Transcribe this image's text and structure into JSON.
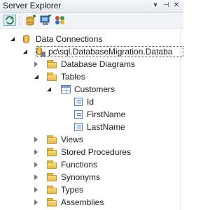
{
  "window": {
    "title": "Server Explorer",
    "controls": [
      "dropdown-icon",
      "pin-icon",
      "close-icon"
    ]
  },
  "toolbar": {
    "buttons": [
      "refresh-icon",
      "connect-to-database-icon",
      "connect-to-server-icon",
      "azure-icon"
    ]
  },
  "tree": {
    "data_connections": "Data Connections",
    "connection": "pc\\sql.DatabaseMigration.Databa",
    "database_diagrams": "Database Diagrams",
    "tables": "Tables",
    "customers": "Customers",
    "columns": [
      "Id",
      "FirstName",
      "LastName"
    ],
    "views": "Views",
    "stored_procedures": "Stored Procedures",
    "functions": "Functions",
    "synonyms": "Synonyms",
    "types": "Types",
    "assemblies": "Assemblies"
  }
}
